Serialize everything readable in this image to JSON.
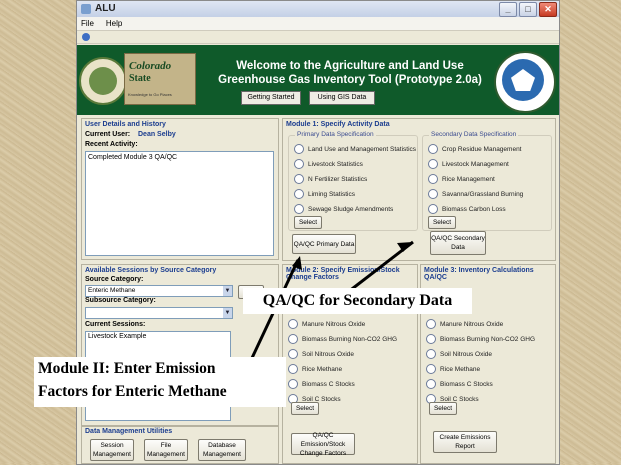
{
  "window": {
    "title": "ALU",
    "min": "_",
    "max": "□",
    "close": "✕"
  },
  "menu": [
    "File",
    "Help"
  ],
  "banner": {
    "title_line1": "Welcome to the Agriculture and Land Use",
    "title_line2": "Greenhouse Gas Inventory Tool (Prototype 2.0a)",
    "getting_started": "Getting Started",
    "using_gis": "Using GIS Data",
    "nrel_logo": "Natural Resource Ecology Laboratory",
    "csu_line1": "Colorado",
    "csu_line2": "State",
    "csu_tagline": "Knowledge to Go Places",
    "epa_top": "UNITED STATES",
    "epa_bottom": "PROTECTION"
  },
  "user": {
    "title": "User Details and History",
    "current_user_label": "Current User:",
    "current_user": "Dean Selby",
    "recent_activity_label": "Recent Activity:",
    "recent_activity": "Completed Module 3 QA/QC"
  },
  "sessions": {
    "title": "Available Sessions by Source Category",
    "source_label": "Source Category:",
    "source_value": "Enteric Methane",
    "subsource_label": "Subsource Category:",
    "subsource_value": "",
    "current_label": "Current Sessions:",
    "current_items": [
      "Livestock Example"
    ]
  },
  "data_mgmt": {
    "title": "Data Management Utilities",
    "session_btn": "Session Management",
    "file_btn": "File Management",
    "db_btn": "Database Management"
  },
  "module1": {
    "title": "Module 1: Specify Activity Data",
    "primary_title": "Primary Data Specification",
    "primary": [
      "Land Use and Management Statistics",
      "Livestock Statistics",
      "N Fertilizer Statistics",
      "Liming Statistics",
      "Sewage Sludge Amendments"
    ],
    "secondary_title": "Secondary Data Specification",
    "secondary": [
      "Crop Residue Management",
      "Livestock Management",
      "Rice Management",
      "Savanna/Grassland Burning",
      "Biomass Carbon Loss"
    ],
    "select": "Select",
    "qa_primary": "QA/QC Primary Data",
    "qa_secondary": "QA/QC Secondary Data"
  },
  "module2": {
    "title": "Module 2: Specify Emission/Stock Change Factors",
    "options": [
      "Manure Nitrous Oxide",
      "Biomass Burning Non-CO2 GHG",
      "Soil Nitrous Oxide",
      "Rice Methane",
      "Biomass C Stocks",
      "Soil C Stocks"
    ],
    "select": "Select",
    "qa_btn": "QA/QC Emission/Stock Change Factors"
  },
  "module3": {
    "title": "Module 3: Inventory Calculations QA/QC",
    "options": [
      "Manure Nitrous Oxide",
      "Biomass Burning Non-CO2 GHG",
      "Soil Nitrous Oxide",
      "Rice Methane",
      "Biomass C Stocks",
      "Soil C Stocks"
    ],
    "select": "Select",
    "report_btn": "Create Emissions Report"
  },
  "callouts": {
    "qa_secondary": "QA/QC for Secondary Data",
    "module2_line1": "Module II: Enter Emission",
    "module2_line2": "Factors for Enteric Methane"
  },
  "colors": {
    "banner": "#0f5a2a",
    "panel_title": "#1b3d8f",
    "window_bg": "#ece9d8"
  }
}
